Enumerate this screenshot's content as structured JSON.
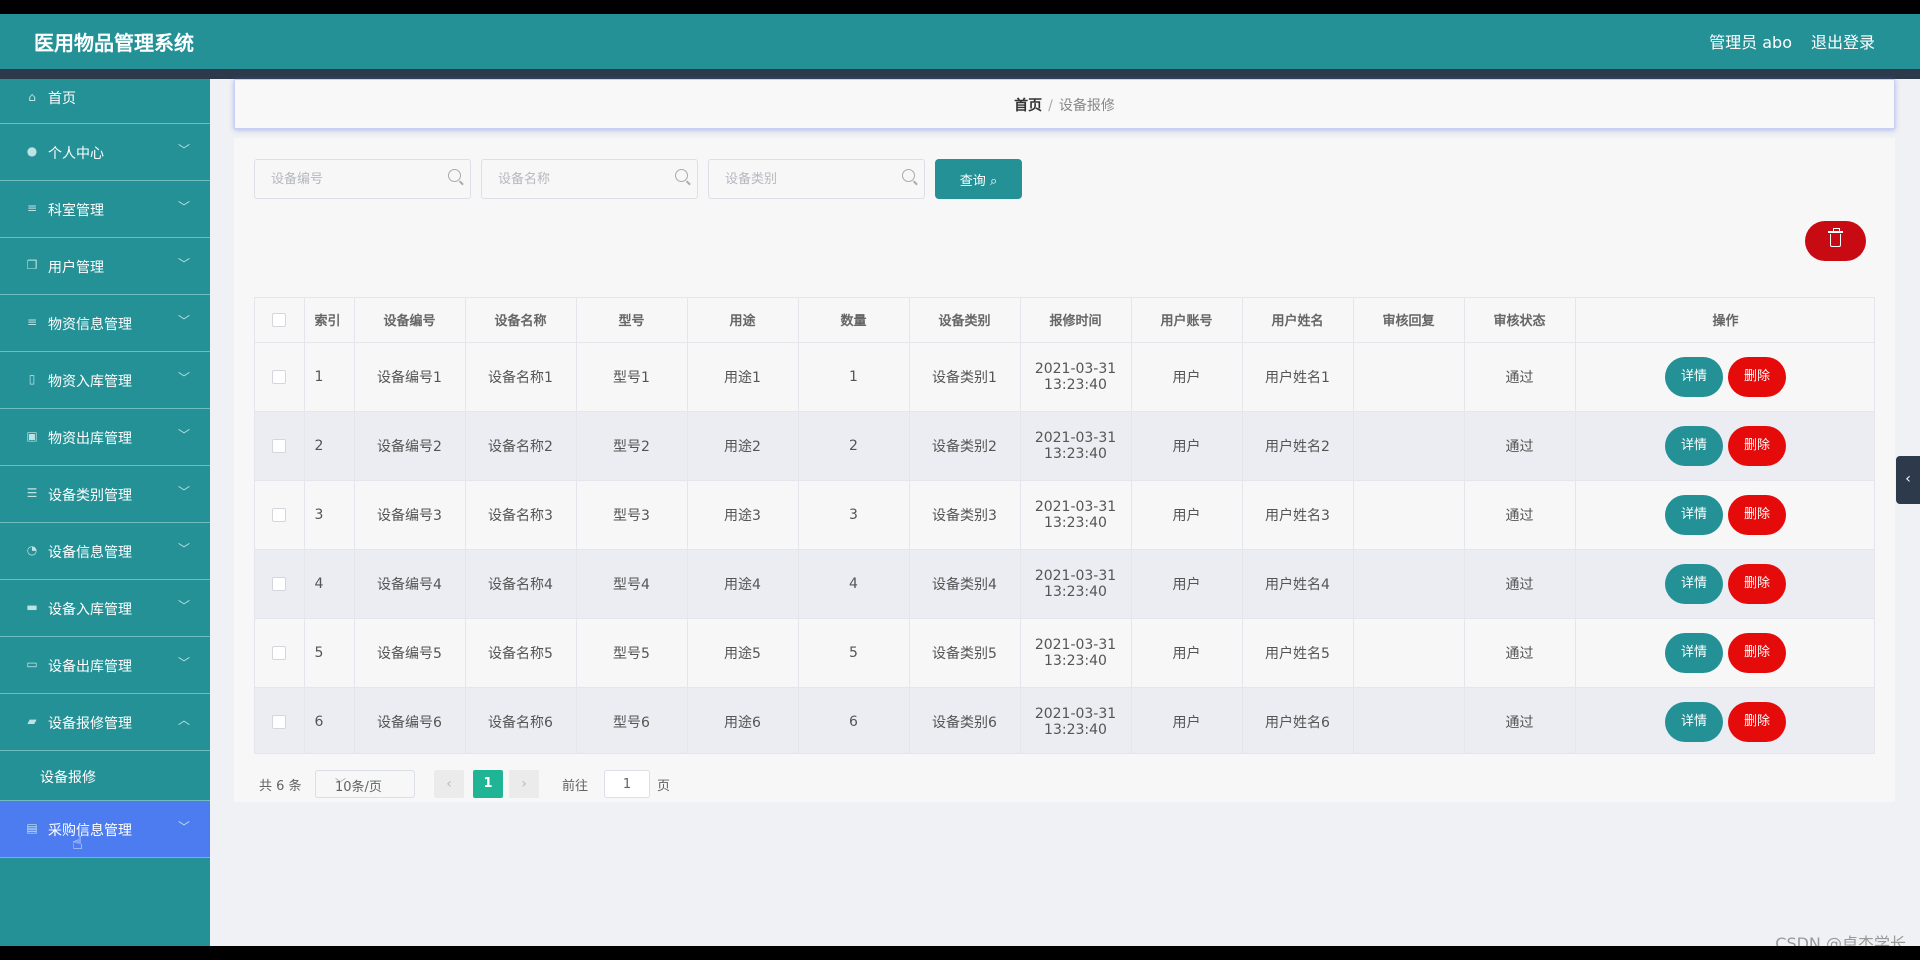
{
  "app": {
    "title": "医用物品管理系统",
    "admin_label": "管理员 abo",
    "logout_label": "退出登录"
  },
  "sidebar": {
    "items": [
      {
        "label": "首页",
        "icon": "home-icon"
      },
      {
        "label": "个人中心",
        "icon": "user-icon"
      },
      {
        "label": "科室管理",
        "icon": "menu-icon"
      },
      {
        "label": "用户管理",
        "icon": "copy-icon"
      },
      {
        "label": "物资信息管理",
        "icon": "menu-icon"
      },
      {
        "label": "物资入库管理",
        "icon": "phone-icon"
      },
      {
        "label": "物资出库管理",
        "icon": "clipboard-icon"
      },
      {
        "label": "设备类别管理",
        "icon": "sliders-icon"
      },
      {
        "label": "设备信息管理",
        "icon": "gauge-icon"
      },
      {
        "label": "设备入库管理",
        "icon": "monitor-icon"
      },
      {
        "label": "设备出库管理",
        "icon": "chat-icon"
      },
      {
        "label": "设备报修管理",
        "icon": "ticket-icon"
      },
      {
        "label": "采购信息管理",
        "icon": "document-icon"
      }
    ],
    "submenu_label": "设备报修"
  },
  "breadcrumb": {
    "home": "首页",
    "separator": "/",
    "current": "设备报修"
  },
  "search": {
    "device_no_placeholder": "设备编号",
    "device_name_placeholder": "设备名称",
    "device_type_placeholder": "设备类别",
    "query_label": "查询"
  },
  "table": {
    "headers": [
      "索引",
      "设备编号",
      "设备名称",
      "型号",
      "用途",
      "数量",
      "设备类别",
      "报修时间",
      "用户账号",
      "用户姓名",
      "审核回复",
      "审核状态",
      "操作"
    ],
    "detail_label": "详情",
    "delete_label": "删除",
    "rows": [
      {
        "index": "1",
        "device_no": "设备编号1",
        "device_name": "设备名称1",
        "model": "型号1",
        "usage": "用途1",
        "qty": "1",
        "category": "设备类别1",
        "date": "2021-03-31",
        "time": "13:23:40",
        "account": "用户",
        "user_name": "用户姓名1",
        "reply": "",
        "status": "通过"
      },
      {
        "index": "2",
        "device_no": "设备编号2",
        "device_name": "设备名称2",
        "model": "型号2",
        "usage": "用途2",
        "qty": "2",
        "category": "设备类别2",
        "date": "2021-03-31",
        "time": "13:23:40",
        "account": "用户",
        "user_name": "用户姓名2",
        "reply": "",
        "status": "通过"
      },
      {
        "index": "3",
        "device_no": "设备编号3",
        "device_name": "设备名称3",
        "model": "型号3",
        "usage": "用途3",
        "qty": "3",
        "category": "设备类别3",
        "date": "2021-03-31",
        "time": "13:23:40",
        "account": "用户",
        "user_name": "用户姓名3",
        "reply": "",
        "status": "通过"
      },
      {
        "index": "4",
        "device_no": "设备编号4",
        "device_name": "设备名称4",
        "model": "型号4",
        "usage": "用途4",
        "qty": "4",
        "category": "设备类别4",
        "date": "2021-03-31",
        "time": "13:23:40",
        "account": "用户",
        "user_name": "用户姓名4",
        "reply": "",
        "status": "通过"
      },
      {
        "index": "5",
        "device_no": "设备编号5",
        "device_name": "设备名称5",
        "model": "型号5",
        "usage": "用途5",
        "qty": "5",
        "category": "设备类别5",
        "date": "2021-03-31",
        "time": "13:23:40",
        "account": "用户",
        "user_name": "用户姓名5",
        "reply": "",
        "status": "通过"
      },
      {
        "index": "6",
        "device_no": "设备编号6",
        "device_name": "设备名称6",
        "model": "型号6",
        "usage": "用途6",
        "qty": "6",
        "category": "设备类别6",
        "date": "2021-03-31",
        "time": "13:23:40",
        "account": "用户",
        "user_name": "用户姓名6",
        "reply": "",
        "status": "通过"
      }
    ]
  },
  "pagination": {
    "total": "共 6 条",
    "page_size": "10条/页",
    "current_page": "1",
    "goto_label": "前往",
    "goto_value": "1",
    "page_label": "页"
  },
  "watermark": "CSDN @卓杰学长",
  "colors": {
    "primary": "#239196",
    "danger": "#e60b0b",
    "hover": "#4d7cf0",
    "page_active": "#1fb494"
  }
}
